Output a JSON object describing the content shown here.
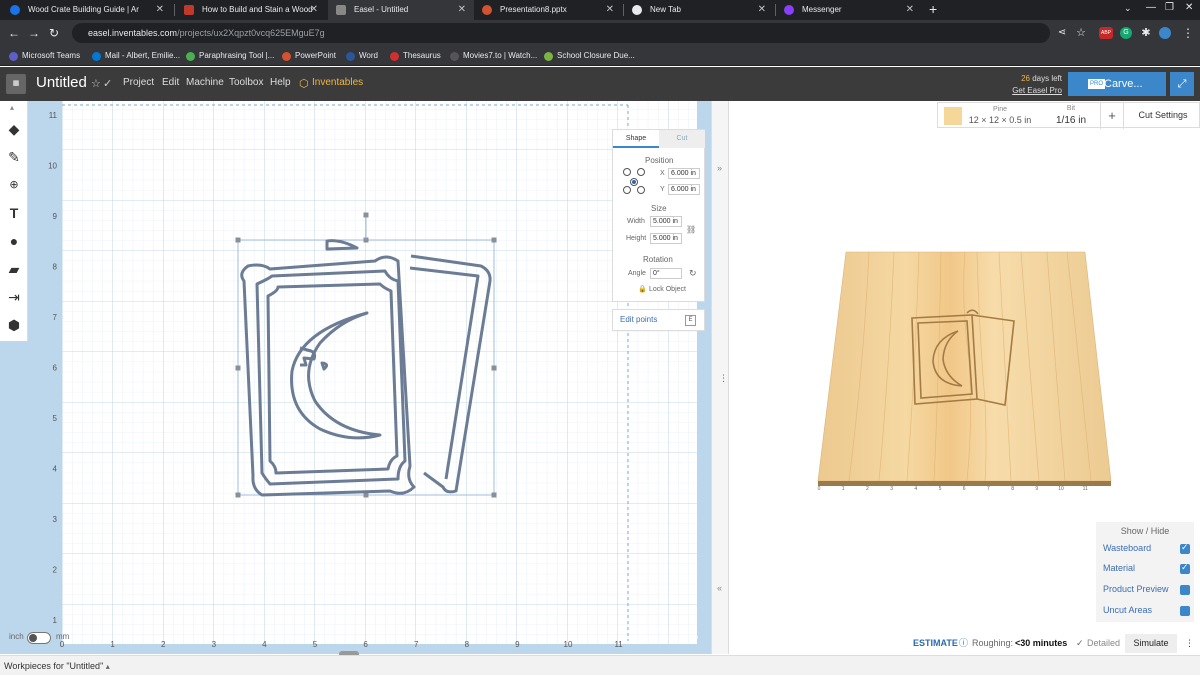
{
  "browser": {
    "tabs": [
      {
        "title": "Wood Crate Building Guide | Ar",
        "color": "#1a73e8"
      },
      {
        "title": "How to Build and Stain a Wood",
        "color": "#c0392b"
      },
      {
        "title": "Easel - Untitled",
        "color": "#777777"
      },
      {
        "title": "Presentation8.pptx",
        "color": "#d35230"
      },
      {
        "title": "New Tab",
        "color": "#e8eaed"
      },
      {
        "title": "Messenger",
        "color": "#8a3ffc"
      }
    ],
    "url_host": "easel.inventables.com",
    "url_path": "/projects/ux2Xqpzt0vcq625EMguE7g",
    "bookmarks": [
      {
        "label": "Microsoft Teams",
        "color": "#5b5fc7"
      },
      {
        "label": "Mail - Albert, Emilie...",
        "color": "#0078d4"
      },
      {
        "label": "Paraphrasing Tool |...",
        "color": "#4caf50"
      },
      {
        "label": "PowerPoint",
        "color": "#d35230"
      },
      {
        "label": "Word",
        "color": "#2b579a"
      },
      {
        "label": "Thesaurus",
        "color": "#d32f2f"
      },
      {
        "label": "Movies7.to | Watch...",
        "color": "#333333"
      },
      {
        "label": "School Closure Due...",
        "color": "#7cb342"
      }
    ]
  },
  "app": {
    "title": "Untitled",
    "menus": [
      "Project",
      "Edit",
      "Machine",
      "Toolbox",
      "Help",
      "Inventables"
    ],
    "days_left_num": "26",
    "days_left_text": " days left",
    "get_pro": "Get Easel Pro",
    "carve_label": "Carve...",
    "pro_badge": "PRO"
  },
  "canvas": {
    "y_ticks": [
      "11",
      "10",
      "9",
      "8",
      "7",
      "6",
      "5",
      "4",
      "3",
      "2",
      "1"
    ],
    "x_ticks": [
      "0",
      "1",
      "2",
      "3",
      "4",
      "5",
      "6",
      "7",
      "8",
      "9",
      "10",
      "11"
    ],
    "unit_in": "inch",
    "unit_mm": "mm"
  },
  "shape_panel": {
    "tab_shape": "Shape",
    "tab_cut": "Cut",
    "position_label": "Position",
    "x_label": "X",
    "x_value": "6.000 in",
    "y_label": "Y",
    "y_value": "6.000 in",
    "size_label": "Size",
    "width_label": "Width",
    "width_value": "5.000 in",
    "height_label": "Height",
    "height_value": "5.000 in",
    "rotation_label": "Rotation",
    "angle_label": "Angle",
    "angle_value": "0°",
    "lock_label": "Lock Object"
  },
  "edit_points": {
    "label": "Edit points",
    "key": "E"
  },
  "material": {
    "name": "Pine",
    "dims": "12 × 12 × 0.5 in",
    "bit_label": "Bit",
    "bit_value": "1/16 in",
    "plus": "+",
    "cut_settings": "Cut Settings"
  },
  "preview_ticks": [
    "0",
    "1",
    "2",
    "3",
    "4",
    "5",
    "6",
    "7",
    "8",
    "9",
    "10",
    "11"
  ],
  "show_hide": {
    "title": "Show / Hide",
    "items": [
      {
        "label": "Wasteboard",
        "checked": true
      },
      {
        "label": "Material",
        "checked": true
      },
      {
        "label": "Product Preview",
        "checked": false
      },
      {
        "label": "Uncut Areas",
        "checked": false
      }
    ]
  },
  "estimate": {
    "label": "ESTIMATE",
    "roughing_label": "Roughing:",
    "roughing_value": "<30 minutes",
    "detailed": "Detailed",
    "simulate": "Simulate"
  },
  "footer": {
    "workpieces": "Workpieces for \"Untitled\""
  }
}
